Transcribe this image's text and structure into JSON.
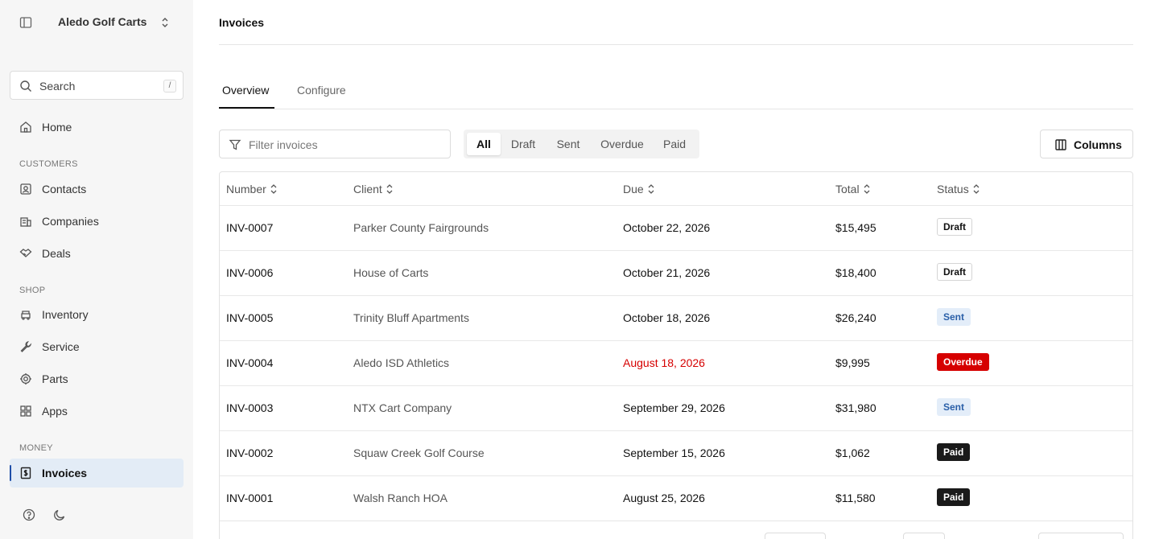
{
  "sidebar": {
    "brand": "Aledo Golf Carts",
    "search": {
      "label": "Search",
      "shortcut": "/"
    },
    "home": "Home",
    "sections": [
      {
        "label": "CUSTOMERS",
        "items": [
          "Contacts",
          "Companies",
          "Deals"
        ]
      },
      {
        "label": "SHOP",
        "items": [
          "Inventory",
          "Service",
          "Parts",
          "Apps"
        ]
      },
      {
        "label": "MONEY",
        "items": [
          "Invoices"
        ]
      }
    ],
    "active_item": "Invoices"
  },
  "page": {
    "title": "Invoices",
    "tabs": [
      {
        "label": "Overview",
        "active": true
      },
      {
        "label": "Configure",
        "active": false
      }
    ],
    "filter_placeholder": "Filter invoices",
    "status_filters": [
      "All",
      "Draft",
      "Sent",
      "Overdue",
      "Paid"
    ],
    "status_filter_selected": "All",
    "columns_button": "Columns"
  },
  "table": {
    "headers": [
      "Number",
      "Client",
      "Due",
      "Total",
      "Status"
    ],
    "rows": [
      {
        "number": "INV-0007",
        "client": "Parker County Fairgrounds",
        "due": "October 22, 2026",
        "total": "$15,495",
        "status": "Draft"
      },
      {
        "number": "INV-0006",
        "client": "House of Carts",
        "due": "October 21, 2026",
        "total": "$18,400",
        "status": "Draft"
      },
      {
        "number": "INV-0005",
        "client": "Trinity Bluff Apartments",
        "due": "October 18, 2026",
        "total": "$26,240",
        "status": "Sent"
      },
      {
        "number": "INV-0004",
        "client": "Aledo ISD Athletics",
        "due": "August 18, 2026",
        "total": "$9,995",
        "status": "Overdue"
      },
      {
        "number": "INV-0003",
        "client": "NTX Cart Company",
        "due": "September 29, 2026",
        "total": "$31,980",
        "status": "Sent"
      },
      {
        "number": "INV-0002",
        "client": "Squaw Creek Golf Course",
        "due": "September 15, 2026",
        "total": "$1,062",
        "status": "Paid"
      },
      {
        "number": "INV-0001",
        "client": "Walsh Ranch HOA",
        "due": "August 25, 2026",
        "total": "$11,580",
        "status": "Paid"
      }
    ]
  },
  "colors": {
    "accent": "#1f4fa8",
    "overdue": "#d60000",
    "sent_bg": "#e3edf9",
    "paid_bg": "#1a1a1a"
  }
}
